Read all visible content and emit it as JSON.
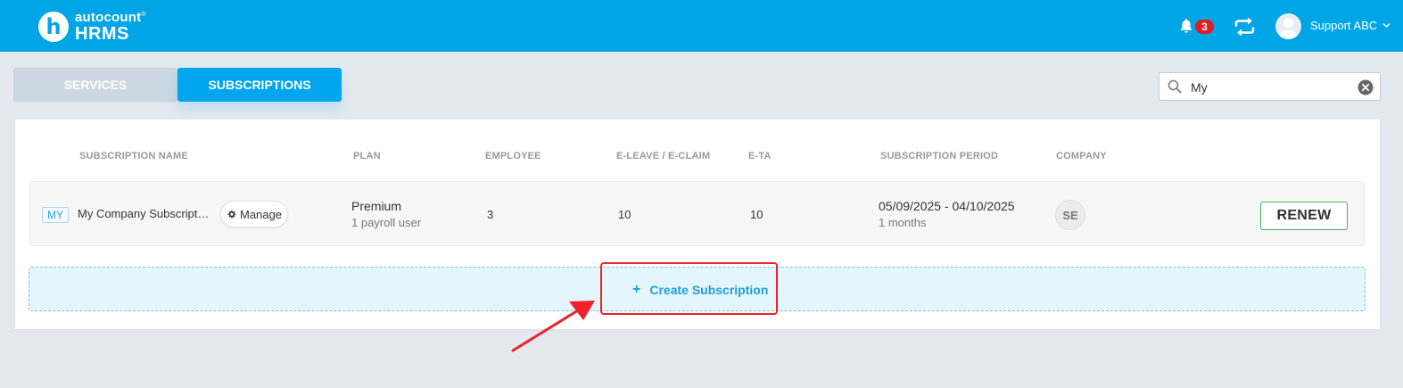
{
  "app": {
    "brand_top": "autocount",
    "brand_mark": "®",
    "brand_bottom": "HRMS",
    "logo_letter": "h"
  },
  "header": {
    "notification_count": "3",
    "user_name": "Support ABC",
    "icons": [
      "bell-icon",
      "sync-icon",
      "avatar",
      "chevron-down-icon"
    ]
  },
  "tabs": [
    {
      "label": "SERVICES",
      "active": false
    },
    {
      "label": "SUBSCRIPTIONS",
      "active": true
    }
  ],
  "search": {
    "value": "My",
    "placeholder": ""
  },
  "table": {
    "columns": [
      "SUBSCRIPTION NAME",
      "PLAN",
      "EMPLOYEE",
      "E-LEAVE / E-CLAIM",
      "E-TA",
      "SUBSCRIPTION PERIOD",
      "COMPANY"
    ],
    "rows": [
      {
        "country_code": "MY",
        "name": "My Company Subscripti...",
        "manage_label": "Manage",
        "plan": "Premium",
        "plan_detail": "1 payroll user",
        "employee": "3",
        "eleave_eclaim": "10",
        "eta": "10",
        "period": "05/09/2025 - 04/10/2025",
        "period_detail": "1 months",
        "company": "SE",
        "renew_label": "RENEW"
      }
    ]
  },
  "create": {
    "icon": "+",
    "label": "Create Subscription"
  },
  "colors": {
    "header_bg": "#00a5e6",
    "active_tab": "#00a5f0",
    "badge": "#e01b24",
    "renew_border": "#46b05a",
    "annotation": "#ee2228"
  }
}
